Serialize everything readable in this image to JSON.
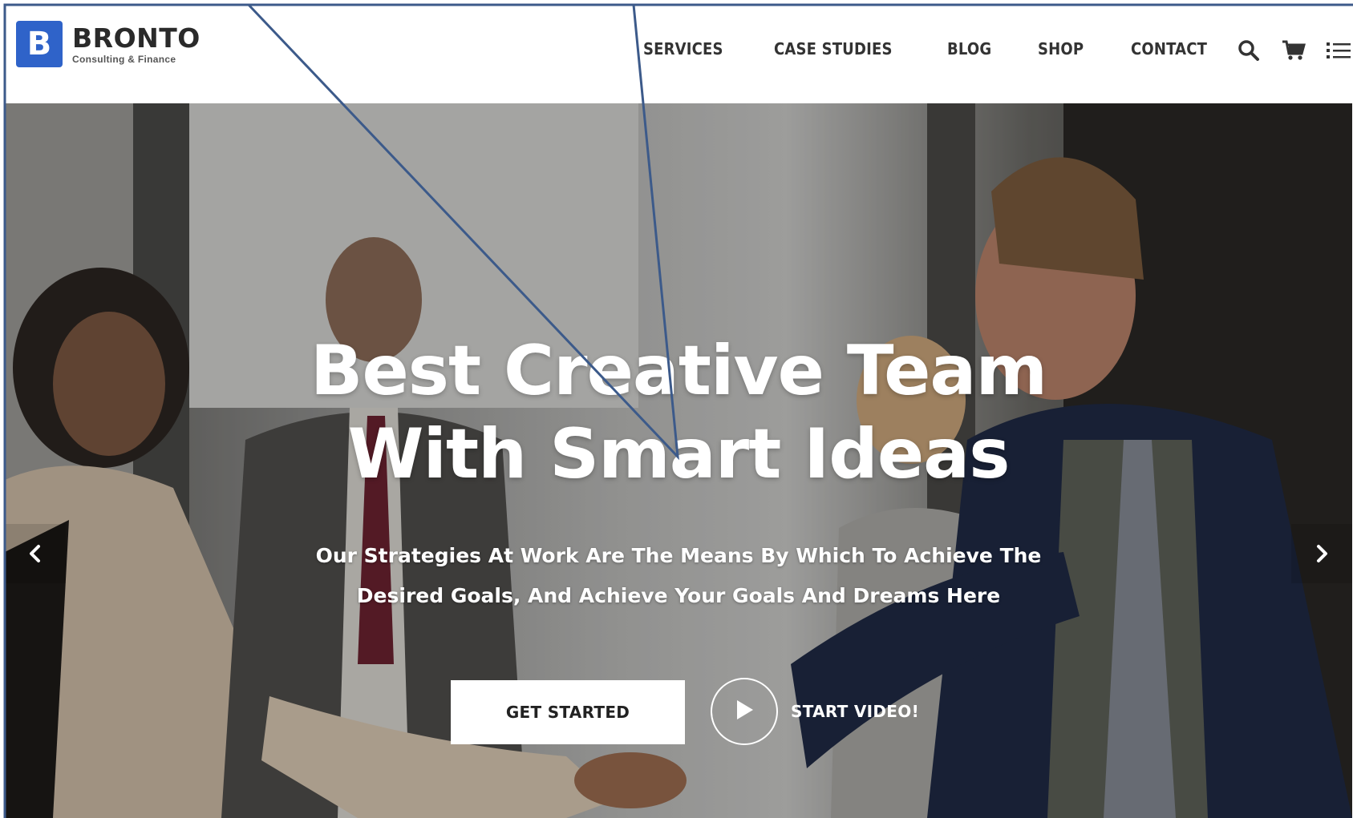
{
  "brand": {
    "mark": "B",
    "name": "BRONTO",
    "tagline": "Consulting & Finance",
    "color": "#2f63c9"
  },
  "nav": {
    "items": [
      {
        "label": "SERVICES"
      },
      {
        "label": "CASE STUDIES"
      },
      {
        "label": "BLOG"
      },
      {
        "label": "SHOP"
      },
      {
        "label": "CONTACT"
      }
    ],
    "icons": [
      "search-icon",
      "cart-icon",
      "menu-list-icon"
    ]
  },
  "hero": {
    "title_line1": "Best Creative Team",
    "title_line2": "With Smart Ideas",
    "subtitle_line1": "Our Strategies At Work Are The Means By Which To Achieve The",
    "subtitle_line2": "Desired Goals, And Achieve Your Goals And Dreams Here",
    "cta_label": "GET STARTED",
    "video_label": "START VIDEO!"
  },
  "callout": {
    "stroke_color": "#3c5a8a"
  }
}
